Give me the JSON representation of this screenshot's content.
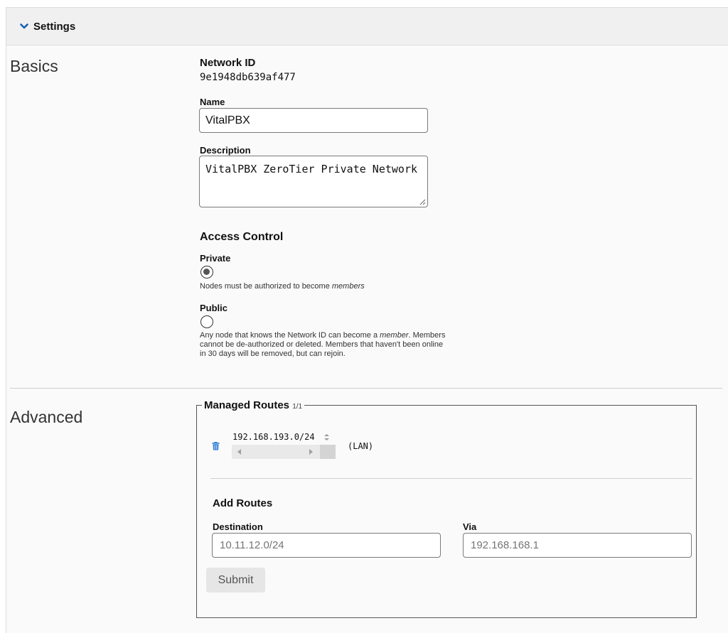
{
  "header": {
    "title": "Settings"
  },
  "basics": {
    "section_label": "Basics",
    "network_id_label": "Network ID",
    "network_id_value": "9e1948db639af477",
    "name_label": "Name",
    "name_value": "VitalPBX",
    "description_label": "Description",
    "description_value": "VitalPBX ZeroTier Private Network",
    "access_control_title": "Access Control",
    "private_label": "Private",
    "private_selected": true,
    "private_help_prefix": "Nodes must be authorized to become ",
    "private_help_em": "members",
    "public_label": "Public",
    "public_selected": false,
    "public_help_line1_prefix": "Any node that knows the Network ID can become a ",
    "public_help_line1_em": "member",
    "public_help_line1_suffix": ". Members",
    "public_help_line2": "cannot be de-authorized or deleted. Members that haven't been online",
    "public_help_line3": "in 30 days will be removed, but can rejoin."
  },
  "advanced": {
    "section_label": "Advanced",
    "managed_routes_title": "Managed Routes",
    "managed_routes_count": "1/1",
    "routes": [
      {
        "destination": "192.168.193.0/24",
        "via": "(LAN)"
      }
    ],
    "add_routes_title": "Add Routes",
    "destination_label": "Destination",
    "destination_placeholder": "10.11.12.0/24",
    "via_label": "Via",
    "via_placeholder": "192.168.168.1",
    "submit_label": "Submit"
  },
  "colors": {
    "trash_icon": "#2f7fd6",
    "header_bg": "#f0f0f0"
  }
}
